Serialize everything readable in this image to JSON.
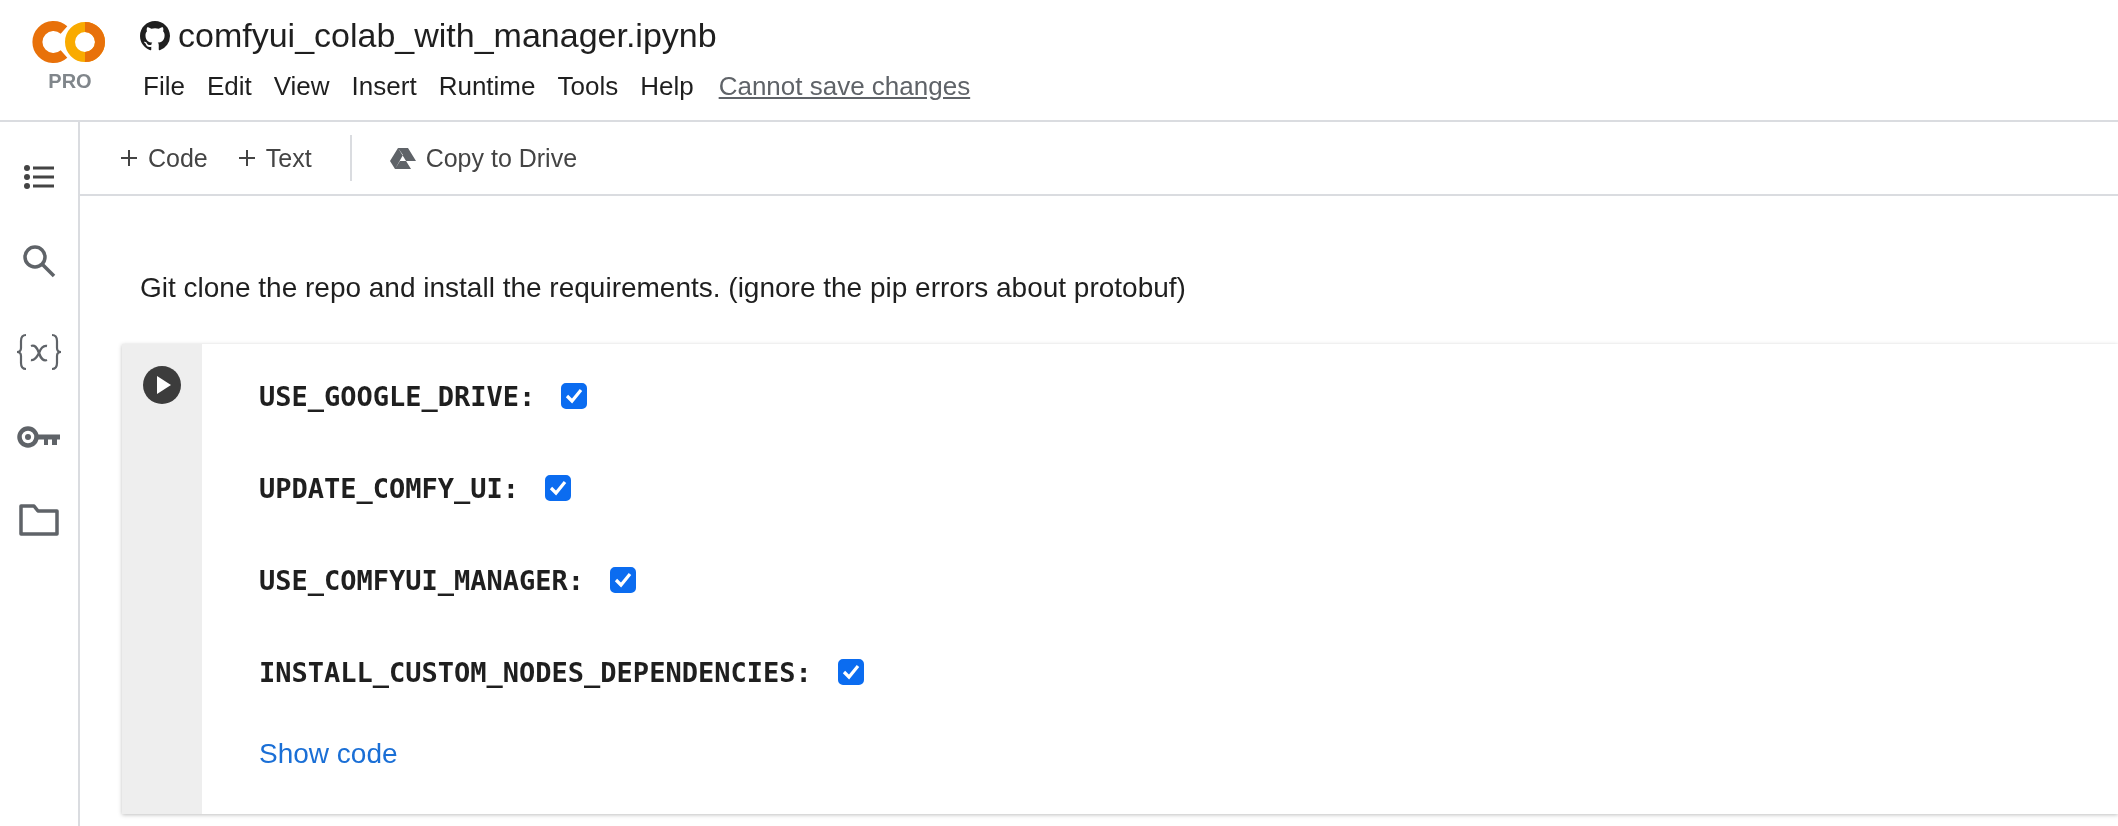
{
  "header": {
    "badge": "PRO",
    "title": "comfyui_colab_with_manager.ipynb",
    "menu": [
      "File",
      "Edit",
      "View",
      "Insert",
      "Runtime",
      "Tools",
      "Help"
    ],
    "save_status": "Cannot save changes"
  },
  "toolbar": {
    "buttons": [
      {
        "kind": "add",
        "label": "Code"
      },
      {
        "kind": "add",
        "label": "Text"
      },
      {
        "kind": "drive",
        "label": "Copy to Drive"
      }
    ]
  },
  "notebook": {
    "text_cell": "Git clone the repo and install the requirements. (ignore the pip errors about protobuf)",
    "form_cell": {
      "fields": [
        {
          "label": "USE_GOOGLE_DRIVE:",
          "checked": true
        },
        {
          "label": "UPDATE_COMFY_UI:",
          "checked": true
        },
        {
          "label": "USE_COMFYUI_MANAGER:",
          "checked": true
        },
        {
          "label": "INSTALL_CUSTOM_NODES_DEPENDENCIES:",
          "checked": true
        }
      ],
      "show_code": "Show code"
    }
  }
}
